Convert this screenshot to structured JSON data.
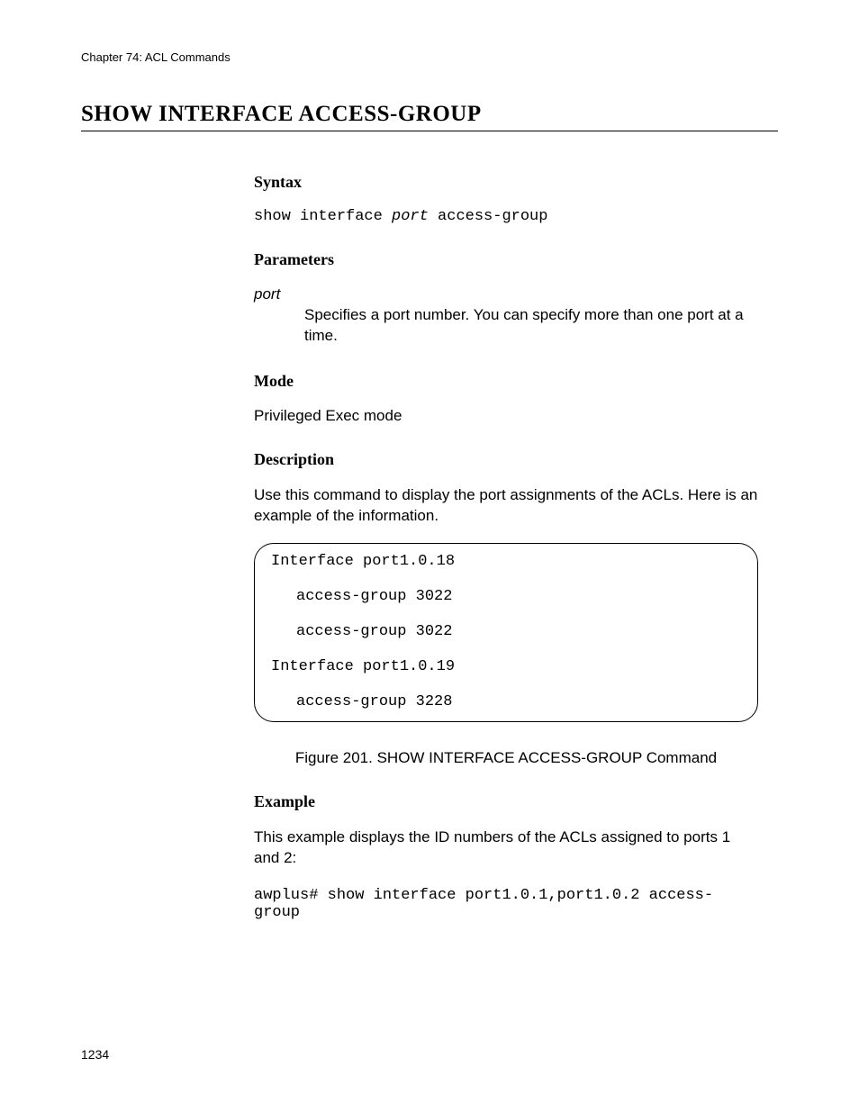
{
  "header": {
    "chapter": "Chapter 74: ACL Commands"
  },
  "title": "SHOW INTERFACE ACCESS-GROUP",
  "sections": {
    "syntax": {
      "heading": "Syntax",
      "cmd_prefix": "show interface ",
      "cmd_arg": "port",
      "cmd_suffix": " access-group"
    },
    "parameters": {
      "heading": "Parameters",
      "name": "port",
      "description": "Specifies a port number. You can specify more than one port at a time."
    },
    "mode": {
      "heading": "Mode",
      "text": "Privileged Exec mode"
    },
    "description": {
      "heading": "Description",
      "text": "Use this command to display the port assignments of the ACLs. Here is an example of the information."
    },
    "output": {
      "lines": [
        {
          "text": "Interface port1.0.18",
          "indent": false
        },
        {
          "text": "access-group 3022",
          "indent": true
        },
        {
          "text": "access-group 3022",
          "indent": true
        },
        {
          "text": "Interface port1.0.19",
          "indent": false
        },
        {
          "text": "access-group 3228",
          "indent": true
        }
      ]
    },
    "figure_caption": "Figure 201. SHOW INTERFACE ACCESS-GROUP Command",
    "example": {
      "heading": "Example",
      "text": "This example displays the ID numbers of the ACLs assigned to ports 1 and 2:",
      "command": "awplus# show interface port1.0.1,port1.0.2 access-group"
    }
  },
  "page_number": "1234"
}
